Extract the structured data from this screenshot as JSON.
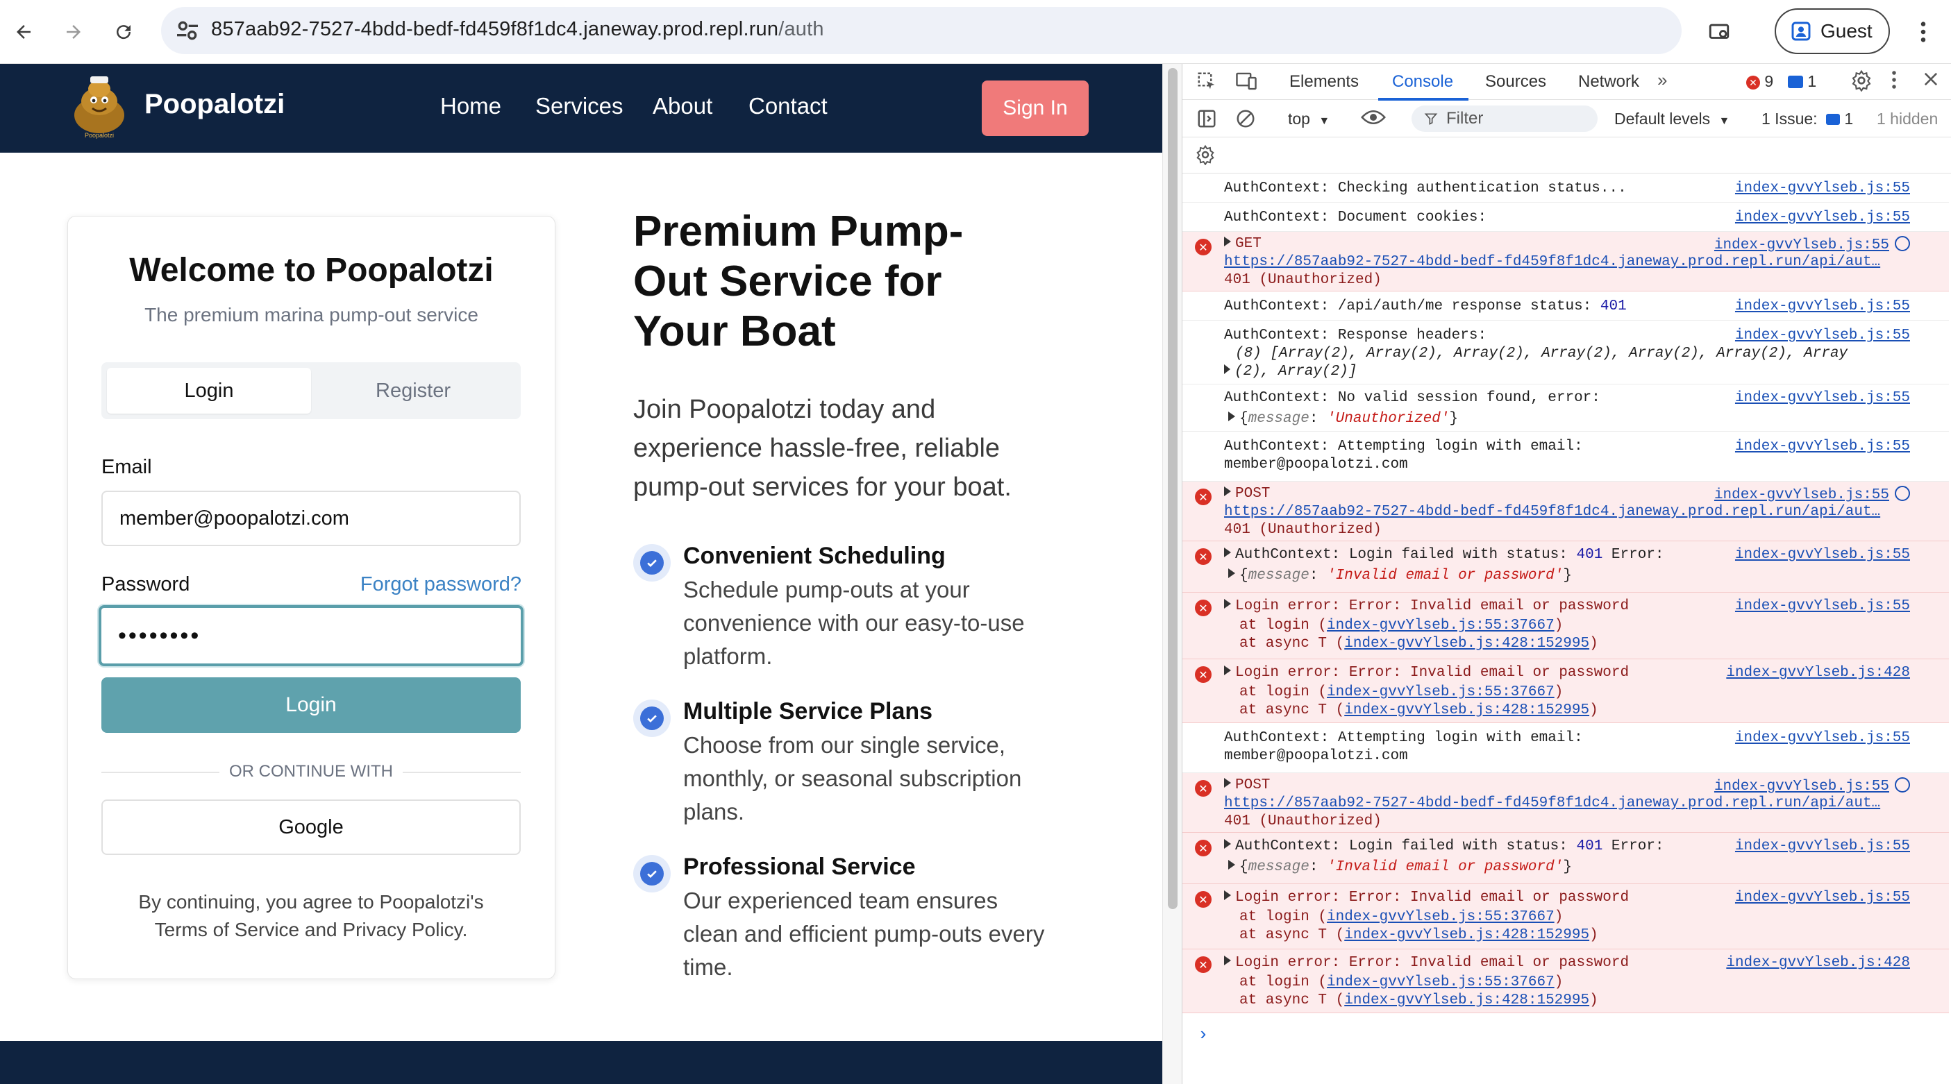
{
  "browser": {
    "url_host": "857aab92-7527-4bdd-bedf-fd459f8f1dc4.janeway.prod.repl.run",
    "url_path": "/auth",
    "profile_label": "Guest"
  },
  "site": {
    "brand": "Poopalotzi",
    "logo_caption": "Poopalotzi",
    "nav": [
      "Home",
      "Services",
      "About",
      "Contact"
    ],
    "signin_label": "Sign In"
  },
  "card": {
    "title": "Welcome to Poopalotzi",
    "subtitle": "The premium marina pump-out service",
    "tabs": [
      "Login",
      "Register"
    ],
    "email_label": "Email",
    "email_value": "member@poopalotzi.com",
    "password_label": "Password",
    "forgot_label": "Forgot password?",
    "password_value": "••••••••",
    "login_button": "Login",
    "divider_text": "OR CONTINUE WITH",
    "google_button": "Google",
    "terms_line1": "By continuing, you agree to Poopalotzi's",
    "terms_line2": "Terms of Service and Privacy Policy."
  },
  "hero": {
    "title_lines": [
      "Premium Pump-",
      "Out Service for",
      "Your Boat"
    ],
    "text_lines": [
      "Join Poopalotzi today and",
      "experience hassle-free, reliable",
      "pump-out services for your boat."
    ],
    "features": [
      {
        "title": "Convenient Scheduling",
        "desc": [
          "Schedule pump-outs at your",
          "convenience with our easy-to-use",
          "platform."
        ]
      },
      {
        "title": "Multiple Service Plans",
        "desc": [
          "Choose from our single service,",
          "monthly, or seasonal subscription",
          "plans."
        ]
      },
      {
        "title": "Professional Service",
        "desc": [
          "Our experienced team ensures",
          "clean and efficient pump-outs every",
          "time."
        ]
      }
    ]
  },
  "devtools": {
    "tabs": [
      "Elements",
      "Console",
      "Sources",
      "Network"
    ],
    "error_count": "9",
    "message_count": "1",
    "context": "top",
    "filter_placeholder": "Filter",
    "levels": "Default levels",
    "issues_label": "1 Issue:",
    "issues_count": "1",
    "hidden_label": "1 hidden"
  },
  "console": {
    "src55": "index-gvvYlseb.js:55",
    "src428": "index-gvvYlseb.js:428",
    "api_url": "https://857aab92-7527-4bdd-bedf-fd459f8f1dc4.janeway.prod.repl.run/api/aut…",
    "m1": "AuthContext: Checking authentication status...",
    "m2": "AuthContext: Document cookies:",
    "get": "GET",
    "unauth": "401 (Unauthorized)",
    "m4a": "AuthContext: /api/auth/me response status:",
    "m4b": "401",
    "m5": "AuthContext: Response headers:",
    "m5b": "(8) [Array(2), Array(2), Array(2), Array(2), Array(2), Array(2), Array",
    "m5c": "(2), Array(2)]",
    "m6": "AuthContext: No valid session found, error:",
    "m6k": "message",
    "m6v": "'Unauthorized'",
    "m7": "AuthContext: Attempting login with email:",
    "m7b": "member@poopalotzi.com",
    "post": "POST",
    "m9": "AuthContext: Login failed with status:",
    "m9n": "401",
    "m9e": "Error:",
    "m9v": "'Invalid email or password'",
    "m10": "Login error: Error: Invalid email or password",
    "at_login": "at login (",
    "at_login_link": "index-gvvYlseb.js:55:37667",
    "at_async": "at async T (",
    "at_async_link": "index-gvvYlseb.js:428:152995",
    "close_paren": ")"
  }
}
